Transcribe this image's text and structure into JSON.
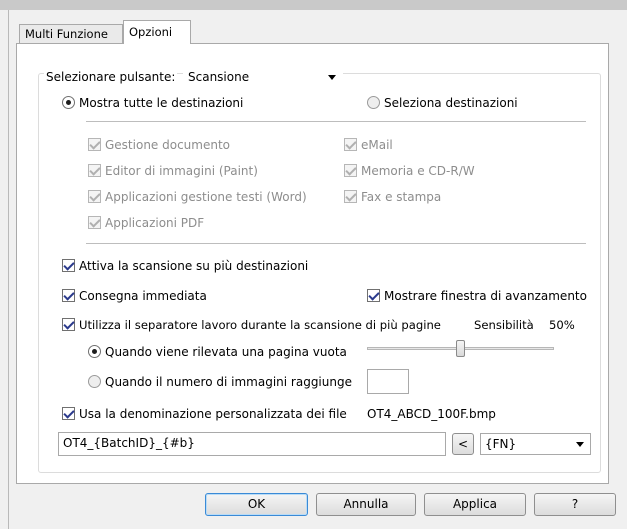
{
  "tabs": [
    {
      "label": "Multi Funzione"
    },
    {
      "label": "Opzioni"
    }
  ],
  "select_button": {
    "label": "Selezionare pulsante:",
    "value": "Scansione"
  },
  "destinations": {
    "show_all": "Mostra tutte le destinazioni",
    "select_dest": "Seleziona destinazioni",
    "items_left": [
      "Gestione documento",
      "Editor di immagini (Paint)",
      "Applicazioni gestione testi (Word)",
      "Applicazioni  PDF"
    ],
    "items_right": [
      "eMail",
      "Memoria e CD-R/W",
      "Fax e stampa"
    ]
  },
  "options": {
    "multi_dest": "Attiva la scansione su più destinazioni",
    "immediate": "Consegna immediata",
    "progress": "Mostrare finestra di avanzamento",
    "separator": "Utilizza il separatore lavoro durante la scansione di più pagine",
    "sensitivity_label": "Sensibilità",
    "sensitivity_value": "50%",
    "sensitivity_level": 0.5,
    "blank_page": "Quando viene rilevata una pagina vuota",
    "image_count": "Quando il numero di immagini raggiunge",
    "image_count_value": "",
    "custom_naming": "Usa la denominazione personalizzata dei file",
    "file_example": "OT4_ABCD_100F.bmp",
    "pattern_value": "OT4_{BatchID}_{#b}",
    "insert_button": "<",
    "token_value": "{FN}"
  },
  "buttons": {
    "ok": "OK",
    "cancel": "Annulla",
    "apply": "Applica",
    "help": "?"
  }
}
